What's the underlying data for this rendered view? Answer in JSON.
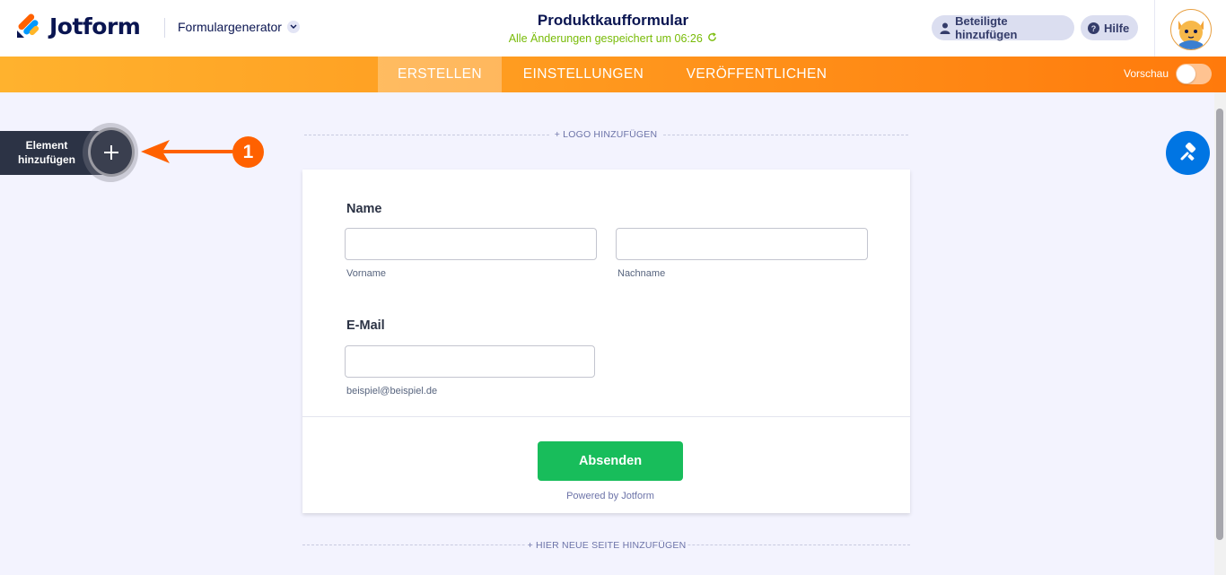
{
  "header": {
    "brand": "Jotform",
    "form_generator": "Formulargenerator",
    "form_title": "Produktkaufformular",
    "save_status": "Alle Änderungen gespeichert um 06:26",
    "add_participants": "Beteiligte hinzufügen",
    "help": "Hilfe"
  },
  "nav": {
    "tabs": [
      {
        "label": "ERSTELLEN",
        "active": true
      },
      {
        "label": "EINSTELLUNGEN",
        "active": false
      },
      {
        "label": "VERÖFFENTLICHEN",
        "active": false
      }
    ],
    "preview_label": "Vorschau",
    "preview_on": false
  },
  "sidebar": {
    "add_element_line1": "Element",
    "add_element_line2": "hinzufügen",
    "step_badge": "1"
  },
  "form": {
    "add_logo": "+ LOGO HINZUFÜGEN",
    "name_label": "Name",
    "first_name_value": "",
    "first_name_sublabel": "Vorname",
    "last_name_value": "",
    "last_name_sublabel": "Nachname",
    "email_label": "E-Mail",
    "email_value": "",
    "email_sublabel": "beispiel@beispiel.de",
    "submit_label": "Absenden",
    "powered_by": "Powered by Jotform",
    "add_page": "+ HIER NEUE SEITE HINZUFÜGEN"
  },
  "colors": {
    "accent_orange": "#ff6100",
    "submit_green": "#18bd5b",
    "designer_blue": "#0075e3",
    "navy": "#0a1551"
  },
  "icons": [
    "jotform-logo-icon",
    "chevron-down-icon",
    "refresh-icon",
    "user-icon",
    "help-icon",
    "avatar",
    "plus-icon",
    "arrow-left-icon",
    "paint-roller-icon"
  ]
}
